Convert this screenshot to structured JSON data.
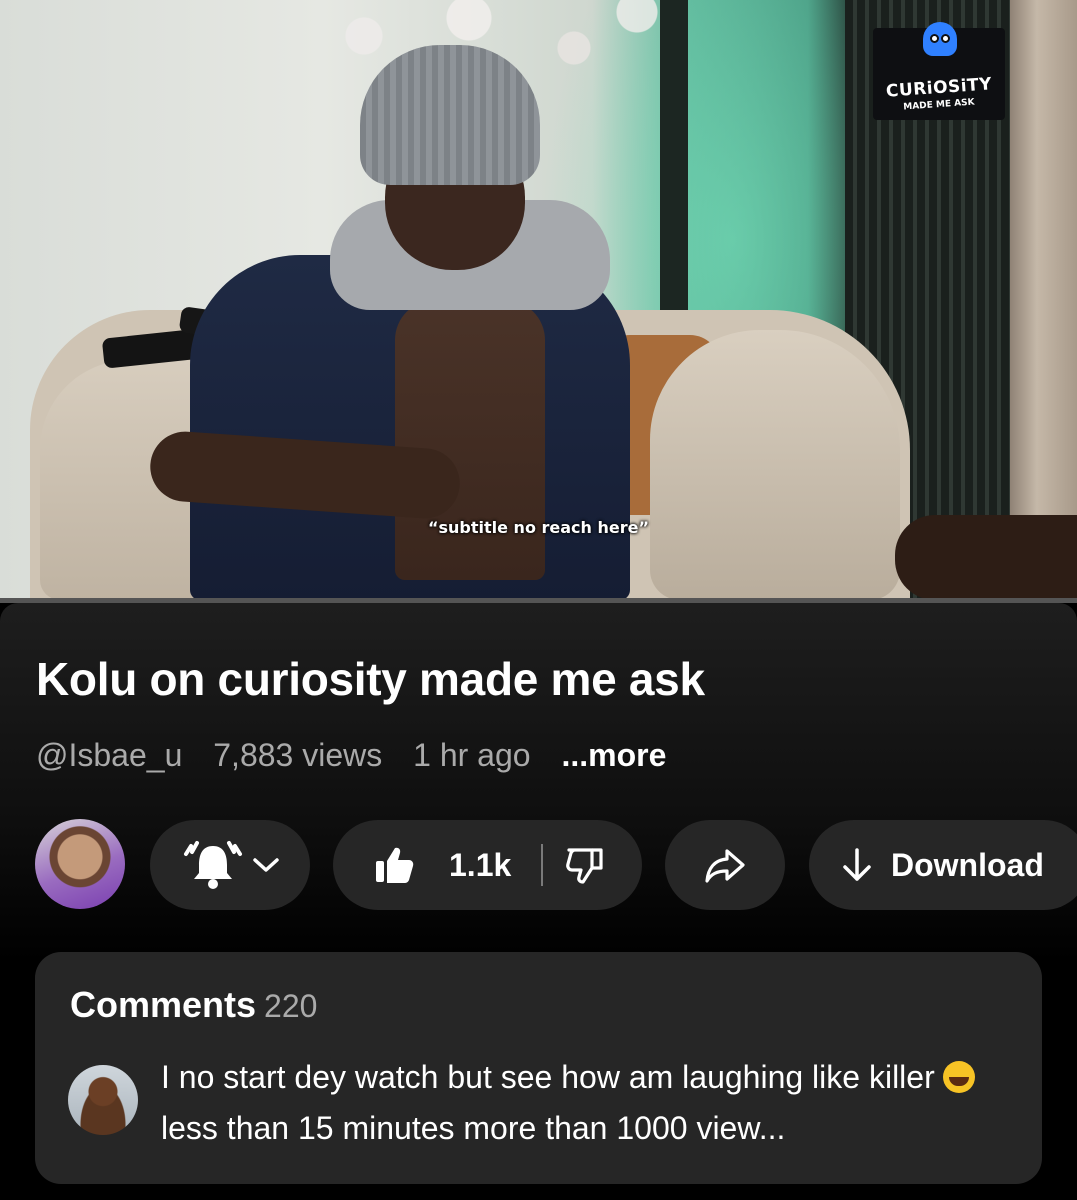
{
  "video": {
    "subtitle": "“subtitle no reach here”",
    "badge_title": "CURiOSiTY",
    "badge_subtitle": "MADE ME ASK",
    "progress_fraction": 0
  },
  "info": {
    "title": "Kolu on curiosity made me ask",
    "channel": "@Isbae_u",
    "views": "7,883 views",
    "age": "1 hr ago",
    "more": "...more"
  },
  "actions": {
    "likes": "1.1k",
    "download": "Download"
  },
  "icons": [
    "bell-icon",
    "chevron-down-icon",
    "thumbs-up-icon",
    "thumbs-down-icon",
    "share-icon",
    "download-arrow-icon"
  ],
  "comments": {
    "heading": "Comments",
    "count": "220",
    "top_comment_part1": "I no start dey watch but see how am laughing like killer",
    "top_comment_part2": "less than 15 minutes more than 1000 view..."
  }
}
